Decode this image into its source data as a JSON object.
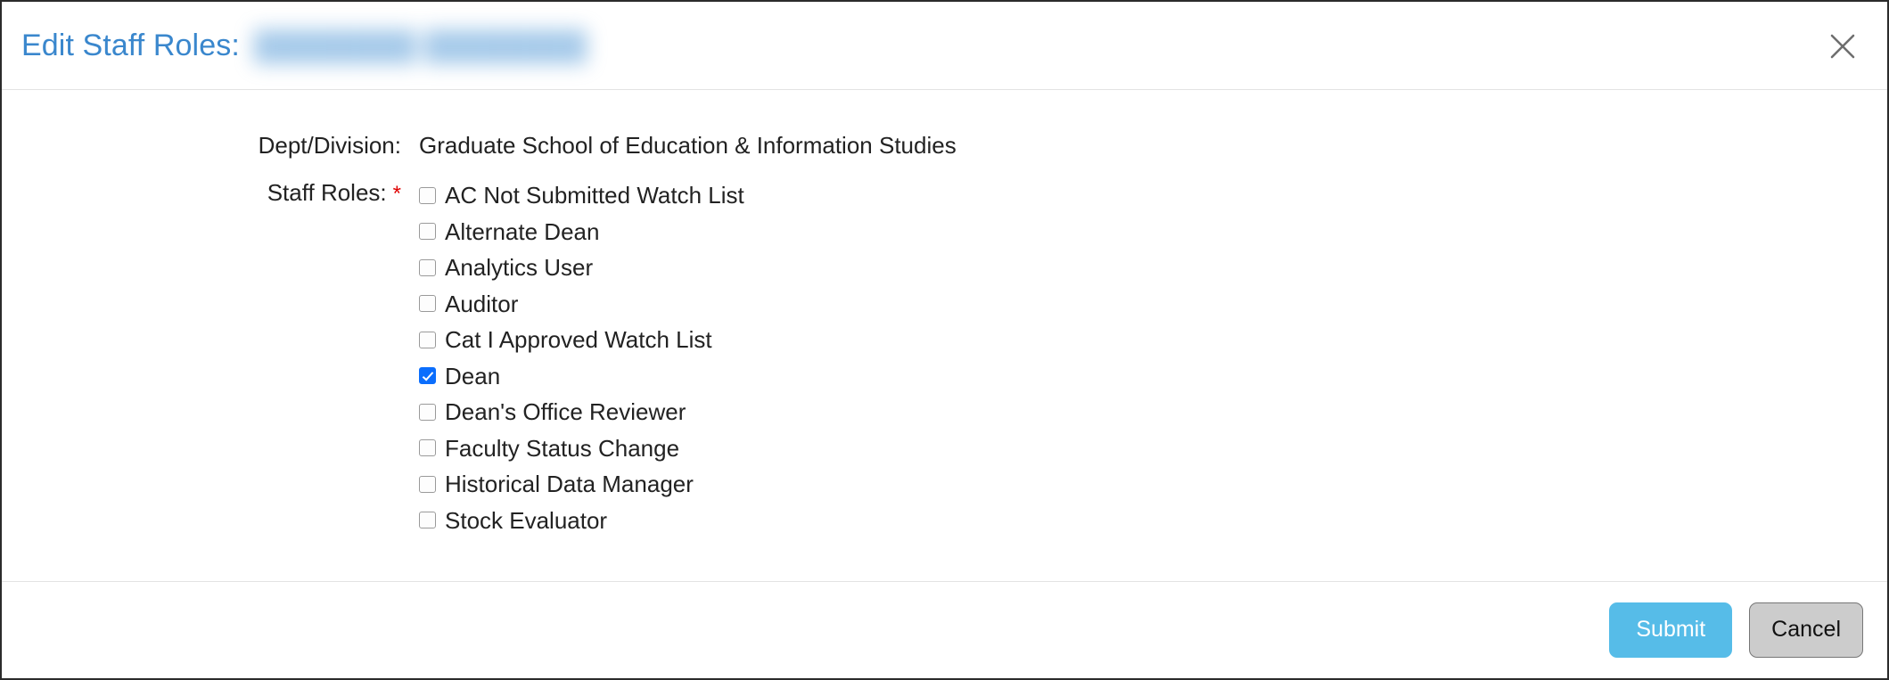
{
  "dialog": {
    "title_prefix": "Edit Staff Roles:",
    "title_redacted_value": "████████ ████████",
    "close_icon": "close-icon",
    "title_color": "#3a87cd"
  },
  "form": {
    "dept_division": {
      "label": "Dept/Division:",
      "value": "Graduate School of Education & Information Studies"
    },
    "staff_roles": {
      "label": "Staff Roles:",
      "required_marker": "*",
      "required_marker_color": "#e00000",
      "options": [
        {
          "label": "AC Not Submitted Watch List",
          "checked": false
        },
        {
          "label": "Alternate Dean",
          "checked": false
        },
        {
          "label": "Analytics User",
          "checked": false
        },
        {
          "label": "Auditor",
          "checked": false
        },
        {
          "label": "Cat I Approved Watch List",
          "checked": false
        },
        {
          "label": "Dean",
          "checked": true
        },
        {
          "label": "Dean's Office Reviewer",
          "checked": false
        },
        {
          "label": "Faculty Status Change",
          "checked": false
        },
        {
          "label": "Historical Data Manager",
          "checked": false
        },
        {
          "label": "Stock Evaluator",
          "checked": false
        }
      ],
      "checked_color": "#0b6efd"
    }
  },
  "footer": {
    "submit_label": "Submit",
    "cancel_label": "Cancel",
    "submit_color": "#56bce8",
    "cancel_color": "#cccccc"
  }
}
